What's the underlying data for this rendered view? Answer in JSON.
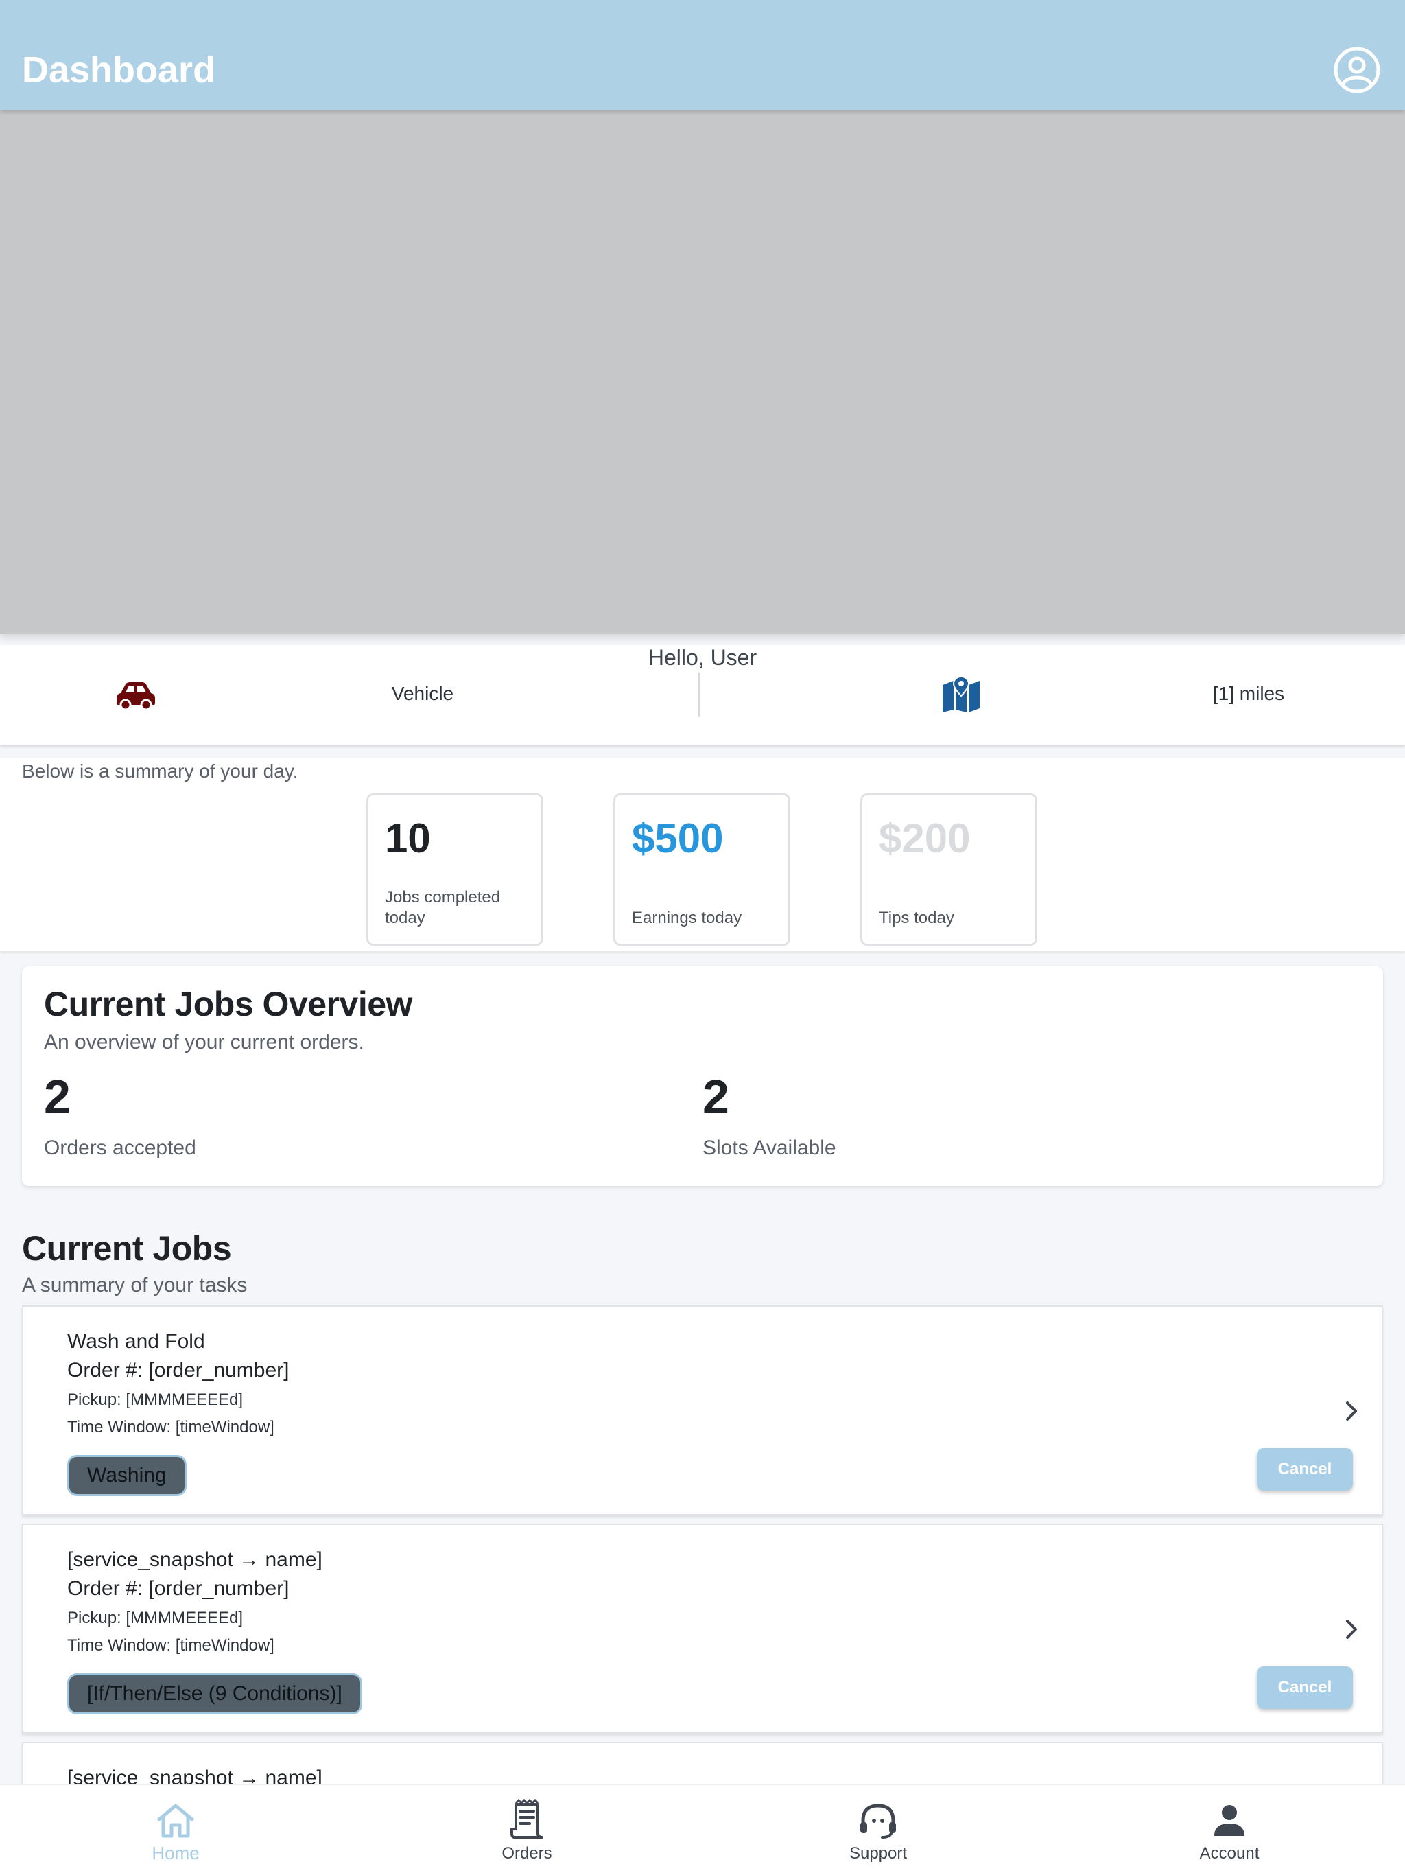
{
  "header": {
    "title": "Dashboard",
    "profile_icon": "user-circle-icon"
  },
  "map": {
    "placeholder": ""
  },
  "info_bar": {
    "greeting": "Hello, User",
    "vehicle_icon": "car-icon",
    "vehicle_icon_color": "#6b0a0a",
    "vehicle_label": "Vehicle",
    "map_icon": "map-icon",
    "map_icon_color": "#1d5f9c",
    "miles_label": "[1] miles"
  },
  "summary": {
    "intro": "Below is a summary of your day.",
    "cards": [
      {
        "value": "10",
        "label": "Jobs completed today",
        "color": "#1f2328"
      },
      {
        "value": "$500",
        "label": "Earnings today",
        "color": "#2796dc"
      },
      {
        "value": "$200",
        "label": "Tips today",
        "color": "#d9dbde"
      }
    ]
  },
  "overview": {
    "title": "Current Jobs Overview",
    "subtitle": "An overview of your current orders.",
    "orders_accepted_value": "2",
    "orders_accepted_label": "Orders accepted",
    "slots_available_value": "2",
    "slots_available_label": "Slots Available"
  },
  "current_jobs": {
    "title": "Current Jobs",
    "subtitle": "A summary of your tasks",
    "jobs": [
      {
        "name": "Wash and Fold",
        "order": "Order #: [order_number]",
        "pickup": "Pickup: [MMMMEEEEd]",
        "time_window": "Time Window: [timeWindow]",
        "status": "Washing",
        "cancel_label": "Cancel"
      },
      {
        "name": "[service_snapshot → name]",
        "order": "Order #: [order_number]",
        "pickup": "Pickup: [MMMMEEEEd]",
        "time_window": "Time Window: [timeWindow]",
        "status": "[If/Then/Else (9 Conditions)]",
        "cancel_label": "Cancel"
      },
      {
        "name": "[service_snapshot → name]"
      }
    ]
  },
  "bottom_nav": {
    "active_color": "#a7cce4",
    "items": [
      {
        "label": "Home",
        "icon": "home-icon"
      },
      {
        "label": "Orders",
        "icon": "receipt-icon"
      },
      {
        "label": "Support",
        "icon": "headset-icon"
      },
      {
        "label": "Account",
        "icon": "person-icon"
      }
    ]
  }
}
